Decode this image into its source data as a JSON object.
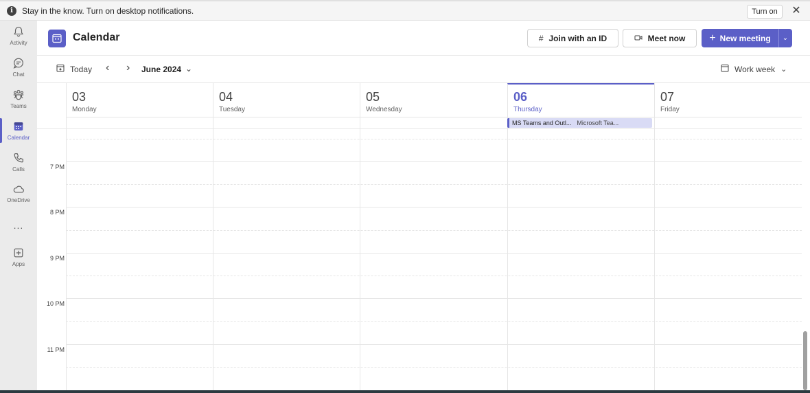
{
  "notification": {
    "message": "Stay in the know. Turn on desktop notifications.",
    "action": "Turn on",
    "info_icon": "info-icon",
    "close_icon": "close-icon"
  },
  "rail": {
    "items": [
      {
        "label": "Activity",
        "icon": "bell-icon"
      },
      {
        "label": "Chat",
        "icon": "chat-icon"
      },
      {
        "label": "Teams",
        "icon": "teams-icon"
      },
      {
        "label": "Calendar",
        "icon": "calendar-icon",
        "active": true
      },
      {
        "label": "Calls",
        "icon": "phone-icon"
      },
      {
        "label": "OneDrive",
        "icon": "cloud-icon"
      },
      {
        "label": "Apps",
        "icon": "add-apps-icon"
      }
    ],
    "more": "..."
  },
  "header": {
    "title": "Calendar",
    "join_label": "Join with an ID",
    "meet_label": "Meet now",
    "new_meeting_label": "New meeting"
  },
  "toolbar": {
    "today_label": "Today",
    "month_label": "June 2024",
    "view_label": "Work week"
  },
  "days": [
    {
      "num": "03",
      "name": "Monday"
    },
    {
      "num": "04",
      "name": "Tuesday"
    },
    {
      "num": "05",
      "name": "Wednesday"
    },
    {
      "num": "06",
      "name": "Thursday",
      "today": true
    },
    {
      "num": "07",
      "name": "Friday"
    }
  ],
  "allday_event": {
    "title": "MS Teams and Outl...",
    "location": "Microsoft Tea..."
  },
  "hours": [
    "7 PM",
    "8 PM",
    "9 PM",
    "10 PM",
    "11 PM"
  ],
  "colors": {
    "accent": "#5b5fc7",
    "event_bg": "#d9dbf5"
  }
}
